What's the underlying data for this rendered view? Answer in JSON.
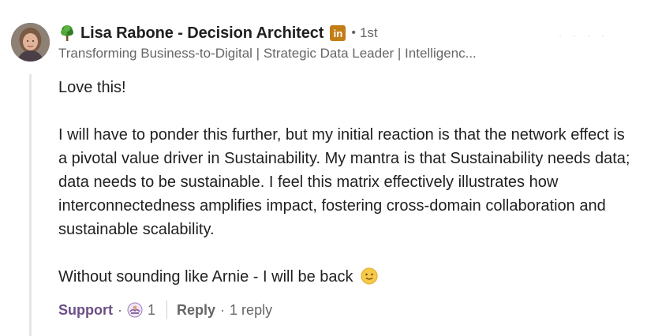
{
  "author": {
    "name": "Lisa Rabone - Decision Architect",
    "badge": "in",
    "degree": "1st",
    "separator_dot": "•",
    "headline": "Transforming Business-to-Digital | Strategic Data Leader | Intelligenc..."
  },
  "comment": {
    "line1": "Love this!",
    "paragraph": "I will have to ponder this further, but my initial reaction is that the network effect is a pivotal value driver in Sustainability. My mantra is that Sustainability needs data; data needs to be sustainable. I feel this matrix effectively illustrates how interconnectedness amplifies impact, fostering cross-domain collaboration and sustainable scalability.",
    "closing": "Without sounding like Arnie - I will be back"
  },
  "actions": {
    "support_label": "Support",
    "sep": "·",
    "reaction_count": "1",
    "reply_label": "Reply",
    "reply_count": "1 reply"
  },
  "colors": {
    "support": "#6b4f86",
    "badge": "#c37d16",
    "muted": "#666666"
  },
  "icons": [
    "tree-icon",
    "linkedin-badge-icon",
    "support-reaction-icon",
    "slightly-smiling-face-icon"
  ]
}
